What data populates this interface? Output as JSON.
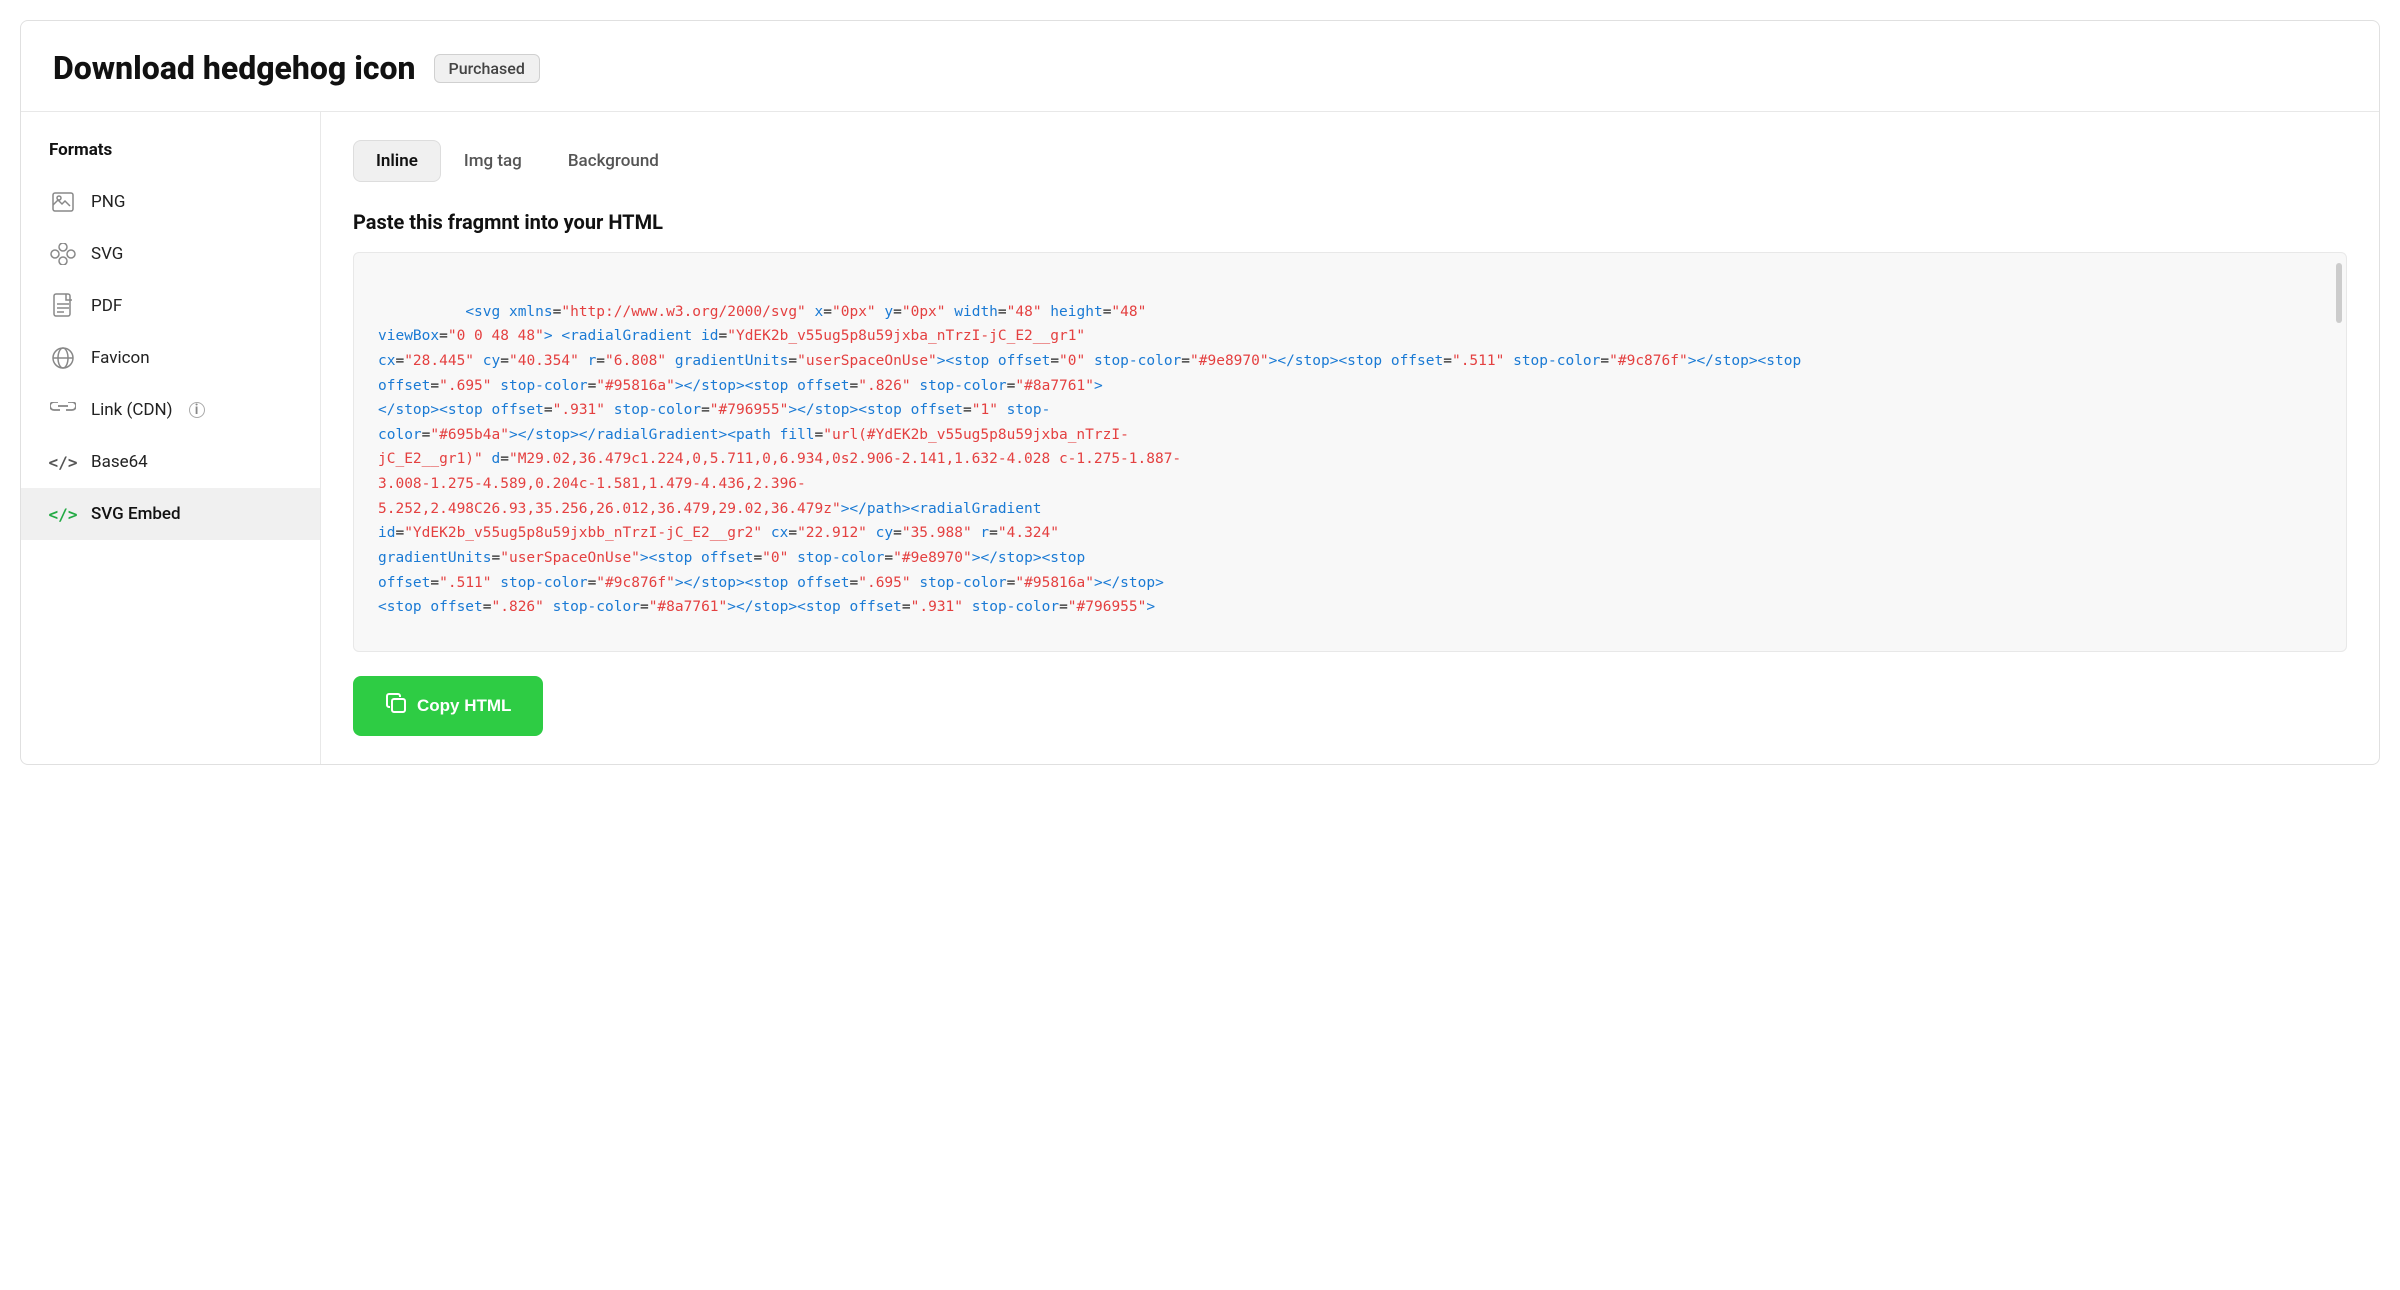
{
  "header": {
    "title": "Download hedgehog icon",
    "badge": "Purchased"
  },
  "sidebar": {
    "title": "Formats",
    "items": [
      {
        "id": "png",
        "label": "PNG",
        "icon": "png",
        "active": false
      },
      {
        "id": "svg",
        "label": "SVG",
        "icon": "svg",
        "active": false
      },
      {
        "id": "pdf",
        "label": "PDF",
        "icon": "pdf",
        "active": false
      },
      {
        "id": "favicon",
        "label": "Favicon",
        "icon": "favicon",
        "active": false
      },
      {
        "id": "cdn",
        "label": "Link (CDN)",
        "icon": "cdn",
        "active": false,
        "info": true
      },
      {
        "id": "base64",
        "label": "Base64",
        "icon": "base64",
        "active": false
      },
      {
        "id": "svgembed",
        "label": "SVG Embed",
        "icon": "svgembed",
        "active": true
      }
    ]
  },
  "main": {
    "tabs": [
      {
        "id": "inline",
        "label": "Inline",
        "active": true
      },
      {
        "id": "imgtag",
        "label": "Img tag",
        "active": false
      },
      {
        "id": "background",
        "label": "Background",
        "active": false
      }
    ],
    "section_title": "Paste this fragmnt into your HTML",
    "code": "<svg xmlns=\"http://www.w3.org/2000/svg\" x=\"0px\" y=\"0px\" width=\"48\" height=\"48\" viewBox=\"0 0 48 48\"> <radialGradient id=\"YdEK2b_v55ug5p8u59jxba_nTrzI-jC_E2__gr1\" cx=\"28.445\" cy=\"40.354\" r=\"6.808\" gradientUnits=\"userSpaceOnUse\"><stop offset=\"0\" stop-color=\"#9e8970\"></stop><stop offset=\".511\" stop-color=\"#9c876f\"></stop><stop offset=\".695\" stop-color=\"#95816a\"></stop><stop offset=\".826\" stop-color=\"#8a7761\"></stop></stop><stop offset=\".931\" stop-color=\"#796955\"></stop><stop offset=\"1\" stop-color=\"#695b4a\"></stop></radialGradient><path fill=\"url(#YdEK2b_v55ug5p8u59jxba_nTrzI-jC_E2__gr1)\" d=\"M29.02,36.479c1.224,0,5.711,0,6.934,0s2.906-2.141,1.632-4.028 c-1.275-1.887-3.008-1.275-4.589,0.204c-1.581,1.479-4.436,2.396-5.252,2.498C26.93,35.256,26.012,36.479,29.02,36.479z\"></path><radialGradient id=\"YdEK2b_v55ug5p8u59jxbb_nTrzI-jC_E2__gr2\" cx=\"22.912\" cy=\"35.988\" r=\"4.324\" gradientUnits=\"userSpaceOnUse\"><stop offset=\"0\" stop-color=\"#9e8970\"></stop><stop offset=\".511\" stop-color=\"#9c876f\"></stop><stop offset=\".695\" stop-color=\"#95816a\"></stop><stop offset=\".826\" stop-color=\"#8a7761\"></stop></stop><stop offset=\".931\" stop-color=\"#796955\">",
    "copy_button_label": "Copy HTML"
  }
}
